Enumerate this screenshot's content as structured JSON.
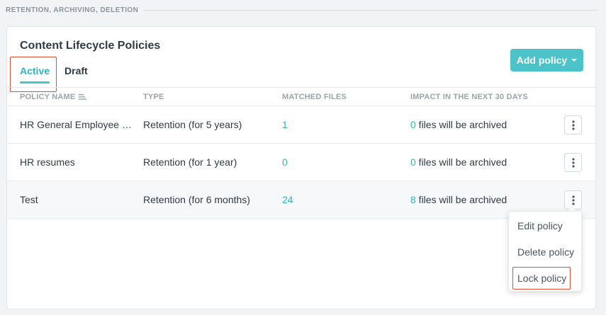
{
  "section": {
    "title": "RETENTION, ARCHIVING, DELETION"
  },
  "card": {
    "title": "Content Lifecycle Policies",
    "tabs": [
      {
        "label": "Active",
        "active": true
      },
      {
        "label": "Draft",
        "active": false
      }
    ],
    "add_button": "Add policy"
  },
  "table": {
    "headers": {
      "name": "POLICY NAME",
      "type": "TYPE",
      "matched": "MATCHED FILES",
      "impact": "IMPACT IN THE NEXT 30 DAYS"
    },
    "rows": [
      {
        "name": "HR General Employee R...",
        "type": "Retention (for 5 years)",
        "matched": "1",
        "impact_count": "0",
        "impact_text": " files will be archived"
      },
      {
        "name": "HR resumes",
        "type": "Retention (for 1 year)",
        "matched": "0",
        "impact_count": "0",
        "impact_text": " files will be archived"
      },
      {
        "name": "Test",
        "type": "Retention (for 6 months)",
        "matched": "24",
        "impact_count": "8",
        "impact_text": " files will be archived"
      }
    ]
  },
  "menu": {
    "items": [
      "Edit policy",
      "Delete policy",
      "Lock policy"
    ]
  },
  "colors": {
    "accent": "#4cc3c8",
    "link": "#2fb5bf",
    "highlight": "#e0502e"
  },
  "icons": {
    "sort": "sort-lines-icon",
    "kebab": "vertical-dots-icon",
    "caret": "caret-down-icon"
  }
}
